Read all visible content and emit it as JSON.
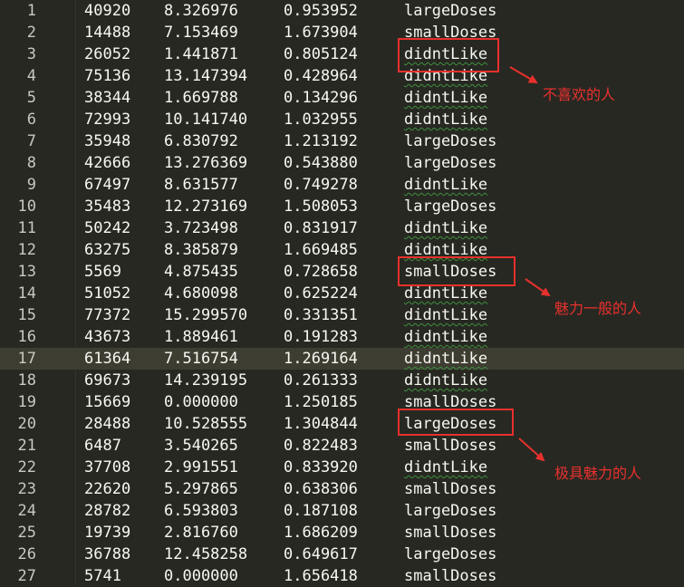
{
  "editor": {
    "rows": [
      {
        "line": "1",
        "a": "40920",
        "b": "8.326976",
        "c": "0.953952",
        "label": "largeDoses"
      },
      {
        "line": "2",
        "a": "14488",
        "b": "7.153469",
        "c": "1.673904",
        "label": "smallDoses"
      },
      {
        "line": "3",
        "a": "26052",
        "b": "1.441871",
        "c": "0.805124",
        "label": "didntLike"
      },
      {
        "line": "4",
        "a": "75136",
        "b": "13.147394",
        "c": "0.428964",
        "label": "didntLike"
      },
      {
        "line": "5",
        "a": "38344",
        "b": "1.669788",
        "c": "0.134296",
        "label": "didntLike"
      },
      {
        "line": "6",
        "a": "72993",
        "b": "10.141740",
        "c": "1.032955",
        "label": "didntLike"
      },
      {
        "line": "7",
        "a": "35948",
        "b": "6.830792",
        "c": "1.213192",
        "label": "largeDoses"
      },
      {
        "line": "8",
        "a": "42666",
        "b": "13.276369",
        "c": "0.543880",
        "label": "largeDoses"
      },
      {
        "line": "9",
        "a": "67497",
        "b": "8.631577",
        "c": "0.749278",
        "label": "didntLike"
      },
      {
        "line": "10",
        "a": "35483",
        "b": "12.273169",
        "c": "1.508053",
        "label": "largeDoses"
      },
      {
        "line": "11",
        "a": "50242",
        "b": "3.723498",
        "c": "0.831917",
        "label": "didntLike"
      },
      {
        "line": "12",
        "a": "63275",
        "b": "8.385879",
        "c": "1.669485",
        "label": "didntLike"
      },
      {
        "line": "13",
        "a": "5569",
        "b": "4.875435",
        "c": "0.728658",
        "label": "smallDoses"
      },
      {
        "line": "14",
        "a": "51052",
        "b": "4.680098",
        "c": "0.625224",
        "label": "didntLike"
      },
      {
        "line": "15",
        "a": "77372",
        "b": "15.299570",
        "c": "0.331351",
        "label": "didntLike"
      },
      {
        "line": "16",
        "a": "43673",
        "b": "1.889461",
        "c": "0.191283",
        "label": "didntLike"
      },
      {
        "line": "17",
        "a": "61364",
        "b": "7.516754",
        "c": "1.269164",
        "label": "didntLike"
      },
      {
        "line": "18",
        "a": "69673",
        "b": "14.239195",
        "c": "0.261333",
        "label": "didntLike"
      },
      {
        "line": "19",
        "a": "15669",
        "b": "0.000000",
        "c": "1.250185",
        "label": "smallDoses"
      },
      {
        "line": "20",
        "a": "28488",
        "b": "10.528555",
        "c": "1.304844",
        "label": "largeDoses"
      },
      {
        "line": "21",
        "a": "6487",
        "b": "3.540265",
        "c": "0.822483",
        "label": "smallDoses"
      },
      {
        "line": "22",
        "a": "37708",
        "b": "2.991551",
        "c": "0.833920",
        "label": "didntLike"
      },
      {
        "line": "23",
        "a": "22620",
        "b": "5.297865",
        "c": "0.638306",
        "label": "smallDoses"
      },
      {
        "line": "24",
        "a": "28782",
        "b": "6.593803",
        "c": "0.187108",
        "label": "largeDoses"
      },
      {
        "line": "25",
        "a": "19739",
        "b": "2.816760",
        "c": "1.686209",
        "label": "smallDoses"
      },
      {
        "line": "26",
        "a": "36788",
        "b": "12.458258",
        "c": "0.649617",
        "label": "largeDoses"
      },
      {
        "line": "27",
        "a": "5741",
        "b": "0.000000",
        "c": "1.656418",
        "label": "smallDoses"
      }
    ],
    "active_line": "17"
  },
  "annotations": [
    {
      "text": "不喜欢的人",
      "row": "3"
    },
    {
      "text": "魅力一般的人",
      "row": "13"
    },
    {
      "text": "极具魅力的人",
      "row": "20"
    }
  ],
  "colors": {
    "background": "#272822",
    "text": "#f8f8f2",
    "line_number": "#c8c8c0",
    "active_line": "#3e3d32",
    "annotation": "#e8302d",
    "spell_squiggle": "#3f8f3f"
  }
}
